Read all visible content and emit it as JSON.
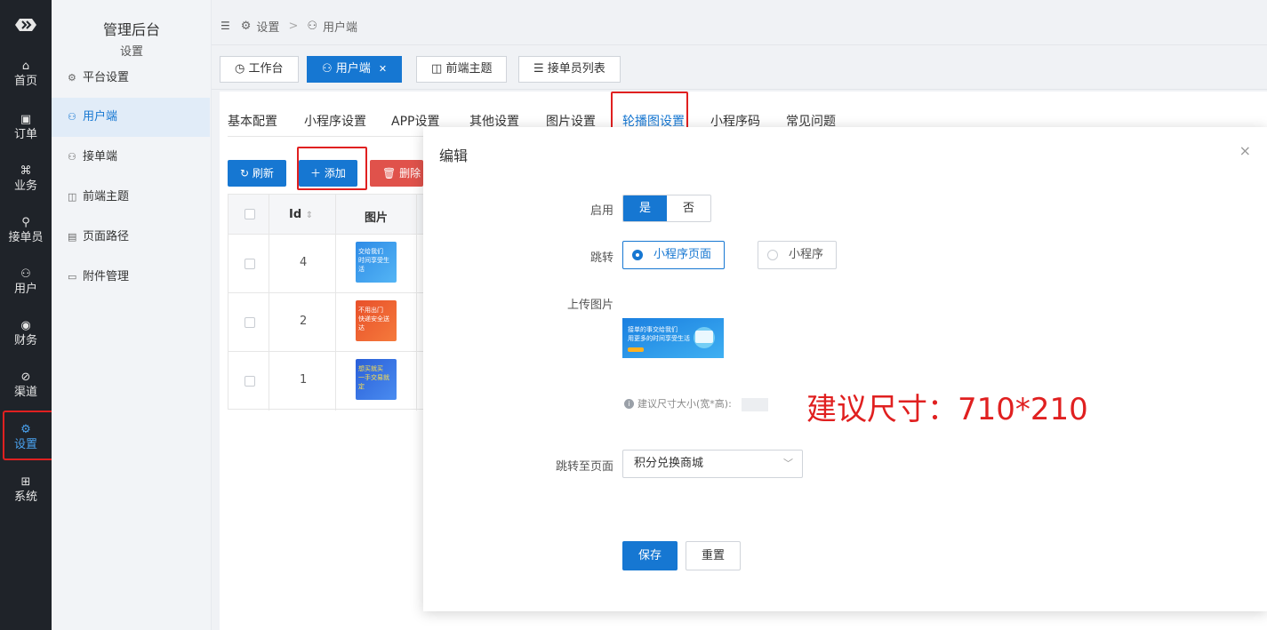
{
  "rail": {
    "items": [
      {
        "label": "首页",
        "icon": "home-icon"
      },
      {
        "label": "订单",
        "icon": "order-icon"
      },
      {
        "label": "业务",
        "icon": "business-icon"
      },
      {
        "label": "接单员",
        "icon": "courier-icon"
      },
      {
        "label": "用户",
        "icon": "user-icon"
      },
      {
        "label": "财务",
        "icon": "finance-icon"
      },
      {
        "label": "渠道",
        "icon": "channel-icon"
      },
      {
        "label": "设置",
        "icon": "settings-icon"
      },
      {
        "label": "系统",
        "icon": "system-icon"
      }
    ],
    "active_index": 7
  },
  "sidebar": {
    "title": "管理后台",
    "subtitle": "设置",
    "items": [
      {
        "label": "平台设置"
      },
      {
        "label": "用户端"
      },
      {
        "label": "接单端"
      },
      {
        "label": "前端主题"
      },
      {
        "label": "页面路径"
      },
      {
        "label": "附件管理"
      }
    ]
  },
  "breadcrumb": {
    "root": "设置",
    "sep": ">",
    "current": "用户端"
  },
  "page_tabs": [
    {
      "label": "工作台"
    },
    {
      "label": "用户端"
    },
    {
      "label": "前端主题"
    },
    {
      "label": "接单员列表"
    }
  ],
  "sub_tabs": [
    {
      "label": "基本配置"
    },
    {
      "label": "小程序设置"
    },
    {
      "label": "APP设置"
    },
    {
      "label": "其他设置"
    },
    {
      "label": "图片设置"
    },
    {
      "label": "轮播图设置"
    },
    {
      "label": "小程序码"
    },
    {
      "label": "常见问题"
    }
  ],
  "toolbar": {
    "refresh": "刷新",
    "add": "添加",
    "delete": "删除"
  },
  "table": {
    "headers": {
      "id": "Id",
      "image": "图片"
    },
    "rows": [
      {
        "id": "4",
        "thumb_lines": [
          "交给我们",
          "时间享受生活"
        ]
      },
      {
        "id": "2",
        "thumb_lines": [
          "不用出门",
          "快递安全送达"
        ]
      },
      {
        "id": "1",
        "thumb_lines": [
          "想买就买",
          "一手交易就定"
        ]
      }
    ]
  },
  "modal": {
    "title": "编辑",
    "close": "×",
    "enable_label": "启用",
    "enable_options": [
      "是",
      "否"
    ],
    "jump_label": "跳转",
    "jump_options": [
      "小程序页面",
      "小程序"
    ],
    "upload_label": "上传图片",
    "banner_lines": [
      "接单的事交给我们",
      "用更多的时间享受生活"
    ],
    "hint": "建议尺寸大小(宽*高):",
    "annotation": "建议尺寸：710*210",
    "target_label": "跳转至页面",
    "target_value": "积分兑换商城",
    "save": "保存",
    "reset": "重置"
  },
  "colors": {
    "primary": "#1677d2",
    "danger": "#e0524b",
    "highlight": "#e02020",
    "rail": "#1f2329"
  }
}
